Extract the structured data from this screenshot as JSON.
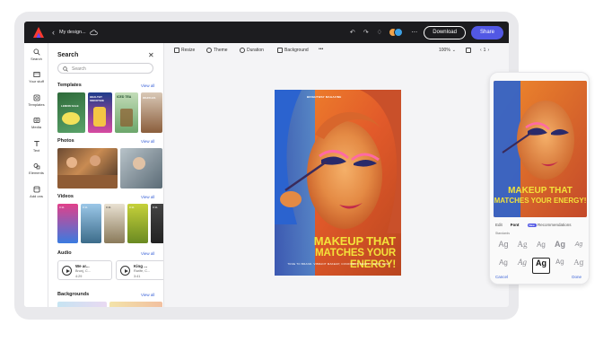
{
  "topbar": {
    "file_title": "My design...",
    "download_label": "Download",
    "share_label": "Share",
    "colors": {
      "bar": "#1c1c1f",
      "share": "#5258e4"
    }
  },
  "leftnav": {
    "items": [
      {
        "label": "Search",
        "icon": "search-icon"
      },
      {
        "label": "Your stuff",
        "icon": "folder-icon"
      },
      {
        "label": "Templates",
        "icon": "templates-icon"
      },
      {
        "label": "Media",
        "icon": "media-icon"
      },
      {
        "label": "Text",
        "icon": "text-icon"
      },
      {
        "label": "Elements",
        "icon": "elements-icon"
      },
      {
        "label": "Add ons",
        "icon": "add-ons-icon"
      }
    ]
  },
  "panel": {
    "title": "Search",
    "search_placeholder": "Search",
    "view_all": "View all",
    "sections": {
      "templates": "Templates",
      "photos": "Photos",
      "videos": "Videos",
      "audio": "Audio",
      "backgrounds": "Backgrounds"
    },
    "template_texts": [
      "LEMON SALE",
      "HEALTHY SMOOTHIE",
      "ICED TEA",
      "WAFFLES"
    ],
    "video_durations": [
      "0:11",
      "0:11",
      "0:11",
      "0:11",
      "0:11"
    ],
    "audio": [
      {
        "title": "We ar...",
        "artist": "Brunj, C...",
        "duration": "4:29"
      },
      {
        "title": "King ...",
        "artist": "Rarife, C...",
        "duration": "3:41"
      }
    ]
  },
  "toolbar": {
    "resize": "Resize",
    "theme": "Theme",
    "duration": "Duration",
    "background": "Background",
    "more": "•••",
    "zoom": "100%",
    "page": "1"
  },
  "poster": {
    "brand": "BRIGHTWAY MAGAZINE",
    "headline_line1": "MAKEUP THAT",
    "headline_line2": "MATCHES YOUR ENERGY!",
    "body": "TRUE TO BRAND. VIBRANT MAKEUP, CONFIDENT BEAUTY. SHOP NOW",
    "colors": {
      "warm": "#e0642a",
      "cool": "#2d6fd6",
      "headline": "#f3e23a"
    }
  },
  "phone": {
    "headline_line1": "MAKEUP THAT",
    "headline_line2": "MATCHES YOUR ENERGY!",
    "tabs": [
      "Edit",
      "Font",
      "Recommendations"
    ],
    "ai_badge": "New",
    "subheading": "Standards",
    "font_glyph": "Ag",
    "cancel": "Cancel",
    "done": "Done"
  }
}
